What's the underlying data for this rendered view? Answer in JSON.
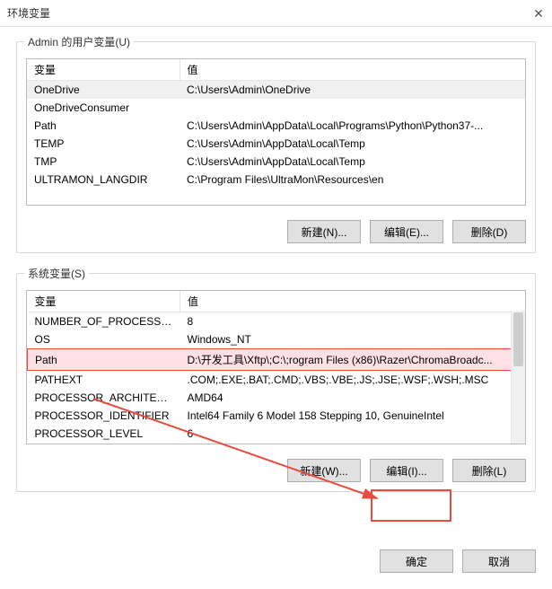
{
  "window": {
    "title": "环境变量",
    "close": "✕"
  },
  "user_section": {
    "label": "Admin 的用户变量(U)",
    "headers": {
      "name": "变量",
      "value": "值"
    },
    "rows": [
      {
        "name": "OneDrive",
        "value": "C:\\Users\\Admin\\OneDrive",
        "selected": true
      },
      {
        "name": "OneDriveConsumer",
        "value": ""
      },
      {
        "name": "Path",
        "value": "C:\\Users\\Admin\\AppData\\Local\\Programs\\Python\\Python37-..."
      },
      {
        "name": "TEMP",
        "value": "C:\\Users\\Admin\\AppData\\Local\\Temp"
      },
      {
        "name": "TMP",
        "value": "C:\\Users\\Admin\\AppData\\Local\\Temp"
      },
      {
        "name": "ULTRAMON_LANGDIR",
        "value": "C:\\Program Files\\UltraMon\\Resources\\en"
      }
    ],
    "buttons": {
      "new": "新建(N)...",
      "edit": "编辑(E)...",
      "del": "删除(D)"
    }
  },
  "sys_section": {
    "label": "系统变量(S)",
    "headers": {
      "name": "变量",
      "value": "值"
    },
    "rows": [
      {
        "name": "NUMBER_OF_PROCESSORS",
        "value": "8"
      },
      {
        "name": "OS",
        "value": "Windows_NT"
      },
      {
        "name": "Path",
        "value": "D:\\开发工具\\Xftp\\;C:\\;rogram Files (x86)\\Razer\\ChromaBroadc...",
        "selected": true
      },
      {
        "name": "PATHEXT",
        "value": ".COM;.EXE;.BAT;.CMD;.VBS;.VBE;.JS;.JSE;.WSF;.WSH;.MSC"
      },
      {
        "name": "PROCESSOR_ARCHITECT...",
        "value": "AMD64"
      },
      {
        "name": "PROCESSOR_IDENTIFIER",
        "value": "Intel64 Family 6 Model 158 Stepping 10, GenuineIntel"
      },
      {
        "name": "PROCESSOR_LEVEL",
        "value": "6"
      }
    ],
    "buttons": {
      "new": "新建(W)...",
      "edit": "编辑(I)...",
      "del": "删除(L)"
    }
  },
  "bottom": {
    "ok": "确定",
    "cancel": "取消"
  }
}
